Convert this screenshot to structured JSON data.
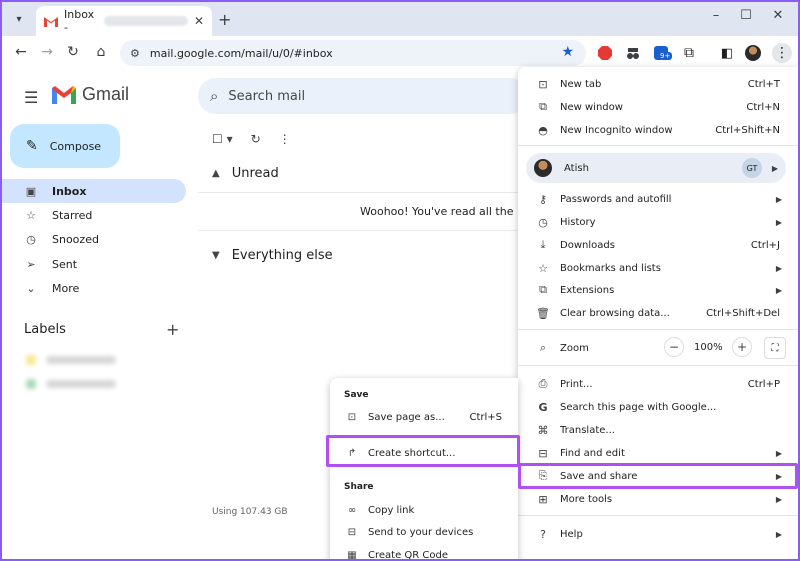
{
  "browser": {
    "tab_title": "Inbox - ",
    "url": "mail.google.com/mail/u/0/#inbox",
    "extension_badge": "9+"
  },
  "gmail": {
    "wordmark": "Gmail",
    "search_placeholder": "Search mail",
    "compose_label": "Compose",
    "nav": [
      "Inbox",
      "Starred",
      "Snoozed",
      "Sent",
      "More"
    ],
    "labels_heading": "Labels",
    "sections": {
      "unread": "Unread",
      "everything_else": "Everything else"
    },
    "empty_message": "Woohoo! You've read all the messages in your inbox.",
    "storage": "Using 107.43 GB"
  },
  "chrome_menu": {
    "new_tab": "New tab",
    "new_tab_sc": "Ctrl+T",
    "new_window": "New window",
    "new_window_sc": "Ctrl+N",
    "incognito": "New Incognito window",
    "incognito_sc": "Ctrl+Shift+N",
    "profile_name": "Atish",
    "profile_initials": "GT",
    "passwords": "Passwords and autofill",
    "history": "History",
    "downloads": "Downloads",
    "downloads_sc": "Ctrl+J",
    "bookmarks": "Bookmarks and lists",
    "extensions": "Extensions",
    "clear_data": "Clear browsing data...",
    "clear_data_sc": "Ctrl+Shift+Del",
    "zoom": "Zoom",
    "zoom_value": "100%",
    "print": "Print...",
    "print_sc": "Ctrl+P",
    "search_page": "Search this page with Google...",
    "translate": "Translate...",
    "find_edit": "Find and edit",
    "save_share": "Save and share",
    "more_tools": "More tools",
    "help": "Help"
  },
  "submenu": {
    "save_heading": "Save",
    "save_page": "Save page as...",
    "save_page_sc": "Ctrl+S",
    "create_shortcut": "Create shortcut...",
    "share_heading": "Share",
    "copy_link": "Copy link",
    "send_devices": "Send to your devices",
    "qr_code": "Create QR Code"
  },
  "colors": {
    "highlight": "#b150f0",
    "accent": "#1a5fd0",
    "frame": "#8b5cf6"
  }
}
